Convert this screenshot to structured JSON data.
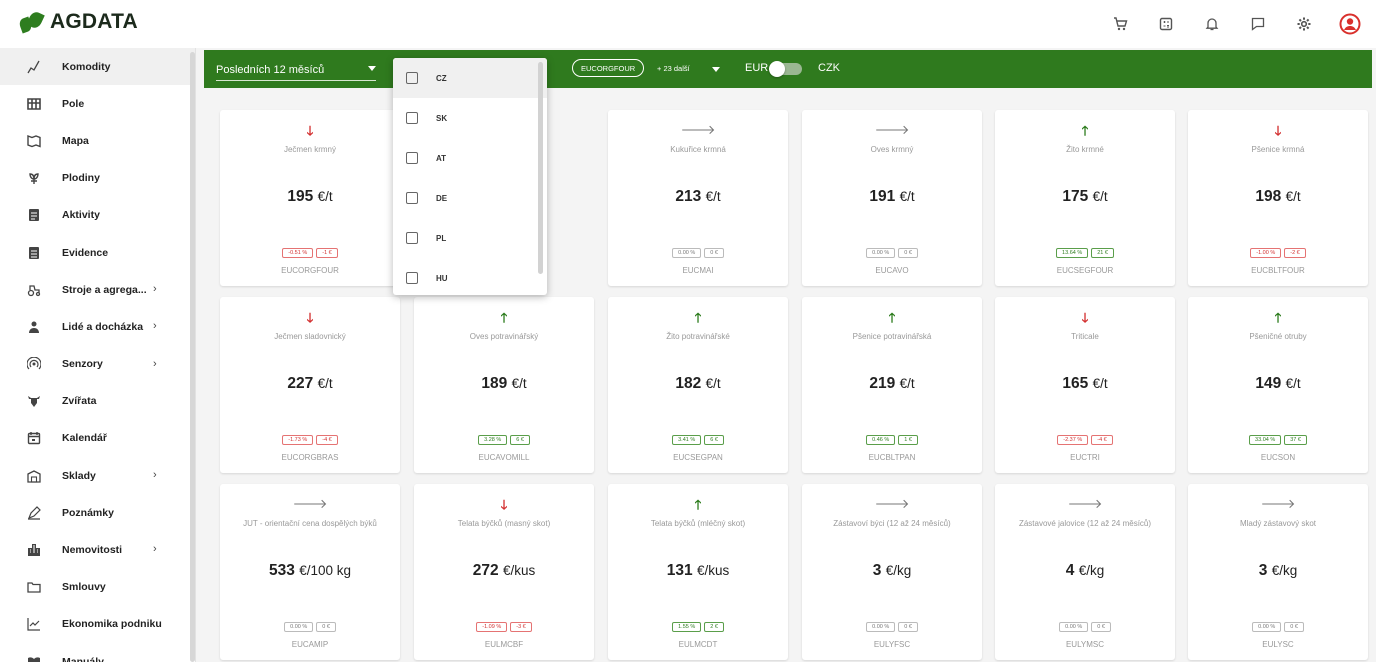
{
  "brand": {
    "name": "AGDATA",
    "color": "#2e7d1f"
  },
  "topbar": {
    "icons": [
      "cart-icon",
      "calculator-icon",
      "bell-icon",
      "chat-icon",
      "gear-icon",
      "account-icon"
    ]
  },
  "sidebar": {
    "items": [
      {
        "label": "Komodity",
        "icon": "chart-line-icon",
        "active": true
      },
      {
        "label": "Pole",
        "icon": "grid-icon"
      },
      {
        "label": "Mapa",
        "icon": "map-icon"
      },
      {
        "label": "Plodiny",
        "icon": "plant-icon"
      },
      {
        "label": "Aktivity",
        "icon": "clipboard-icon"
      },
      {
        "label": "Evidence",
        "icon": "document-icon"
      },
      {
        "label": "Stroje a agrega...",
        "icon": "tractor-icon",
        "submenu": true
      },
      {
        "label": "Lidé a docházka",
        "icon": "person-icon",
        "submenu": true
      },
      {
        "label": "Senzory",
        "icon": "sensor-icon",
        "submenu": true
      },
      {
        "label": "Zvířata",
        "icon": "cow-icon"
      },
      {
        "label": "Kalendář",
        "icon": "calendar-icon"
      },
      {
        "label": "Sklady",
        "icon": "warehouse-icon",
        "submenu": true
      },
      {
        "label": "Poznámky",
        "icon": "pencil-icon"
      },
      {
        "label": "Nemovitosti",
        "icon": "building-icon",
        "submenu": true
      },
      {
        "label": "Smlouvy",
        "icon": "folder-icon"
      },
      {
        "label": "Ekonomika podniku",
        "icon": "trend-icon"
      },
      {
        "label": "Manuály",
        "icon": "book-icon"
      }
    ]
  },
  "filters": {
    "period": "Posledních 12 měsíců",
    "commodity_chip": "EUCORGFOUR",
    "commodity_more": "+ 23 další",
    "currency_left": "EUR",
    "currency_right": "CZK"
  },
  "country_dropdown": {
    "options": [
      "CZ",
      "SK",
      "AT",
      "DE",
      "PL",
      "HU"
    ]
  },
  "cards": [
    {
      "trend": "down",
      "arrow": "🡓",
      "name": "Ječmen krmný",
      "price": "195",
      "unit": "€/t",
      "pct": "-0.51 %",
      "abs": "-1 €",
      "sign": "neg",
      "code": "EUCORGFOUR"
    },
    {
      "trend": "flat",
      "arrow": "",
      "name": "",
      "price": "",
      "unit": "",
      "pct": "",
      "abs": "",
      "sign": "neutral",
      "code": "",
      "hidden": true
    },
    {
      "trend": "flat",
      "arrow": "🡒",
      "name": "Kukuřice krmná",
      "price": "213",
      "unit": "€/t",
      "pct": "0.00 %",
      "abs": "0 €",
      "sign": "neutral",
      "code": "EUCMAI"
    },
    {
      "trend": "flat",
      "arrow": "🡒",
      "name": "Oves krmný",
      "price": "191",
      "unit": "€/t",
      "pct": "0.00 %",
      "abs": "0 €",
      "sign": "neutral",
      "code": "EUCAVO"
    },
    {
      "trend": "up",
      "arrow": "🡑",
      "name": "Žito krmné",
      "price": "175",
      "unit": "€/t",
      "pct": "13.64 %",
      "abs": "21 €",
      "sign": "pos",
      "code": "EUCSEGFOUR"
    },
    {
      "trend": "down",
      "arrow": "🡓",
      "name": "Pšenice krmná",
      "price": "198",
      "unit": "€/t",
      "pct": "-1.00 %",
      "abs": "-2 €",
      "sign": "neg",
      "code": "EUCBLTFOUR"
    },
    {
      "trend": "down",
      "arrow": "🡓",
      "name": "Ječmen sladovnický",
      "price": "227",
      "unit": "€/t",
      "pct": "-1.73 %",
      "abs": "-4 €",
      "sign": "neg",
      "code": "EUCORGBRAS"
    },
    {
      "trend": "up",
      "arrow": "🡑",
      "name": "Oves potravinářský",
      "price": "189",
      "unit": "€/t",
      "pct": "3.28 %",
      "abs": "6 €",
      "sign": "pos",
      "code": "EUCAVOMILL"
    },
    {
      "trend": "up",
      "arrow": "🡑",
      "name": "Žito potravinářské",
      "price": "182",
      "unit": "€/t",
      "pct": "3.41 %",
      "abs": "6 €",
      "sign": "pos",
      "code": "EUCSEGPAN"
    },
    {
      "trend": "up",
      "arrow": "🡑",
      "name": "Pšenice potravinářská",
      "price": "219",
      "unit": "€/t",
      "pct": "0.46 %",
      "abs": "1 €",
      "sign": "pos",
      "code": "EUCBLTPAN"
    },
    {
      "trend": "down",
      "arrow": "🡓",
      "name": "Triticale",
      "price": "165",
      "unit": "€/t",
      "pct": "-2.37 %",
      "abs": "-4 €",
      "sign": "neg",
      "code": "EUCTRI"
    },
    {
      "trend": "up",
      "arrow": "🡑",
      "name": "Pšeničné otruby",
      "price": "149",
      "unit": "€/t",
      "pct": "33.04 %",
      "abs": "37 €",
      "sign": "pos",
      "code": "EUCSON"
    },
    {
      "trend": "flat",
      "arrow": "🡒",
      "name": "JUT - orientační cena dospělých býků",
      "price": "533",
      "unit": "€/100 kg",
      "pct": "0.00 %",
      "abs": "0 €",
      "sign": "neutral",
      "code": "EUCAMIP"
    },
    {
      "trend": "down",
      "arrow": "🡓",
      "name": "Telata býčků (masný skot)",
      "price": "272",
      "unit": "€/kus",
      "pct": "-1.09 %",
      "abs": "-3 €",
      "sign": "neg",
      "code": "EULMCBF"
    },
    {
      "trend": "up",
      "arrow": "🡑",
      "name": "Telata býčků (mléčný skot)",
      "price": "131",
      "unit": "€/kus",
      "pct": "1.55 %",
      "abs": "2 €",
      "sign": "pos",
      "code": "EULMCDT"
    },
    {
      "trend": "flat",
      "arrow": "🡒",
      "name": "Zástavoví býci (12 až 24 měsíců)",
      "price": "3",
      "unit": "€/kg",
      "pct": "0.00 %",
      "abs": "0 €",
      "sign": "neutral",
      "code": "EULYFSC"
    },
    {
      "trend": "flat",
      "arrow": "🡒",
      "name": "Zástavové jalovice (12 až 24 měsíců)",
      "price": "4",
      "unit": "€/kg",
      "pct": "0.00 %",
      "abs": "0 €",
      "sign": "neutral",
      "code": "EULYMSC"
    },
    {
      "trend": "flat",
      "arrow": "🡒",
      "name": "Mladý zástavový skot",
      "price": "3",
      "unit": "€/kg",
      "pct": "0.00 %",
      "abs": "0 €",
      "sign": "neutral",
      "code": "EULYSC"
    }
  ]
}
